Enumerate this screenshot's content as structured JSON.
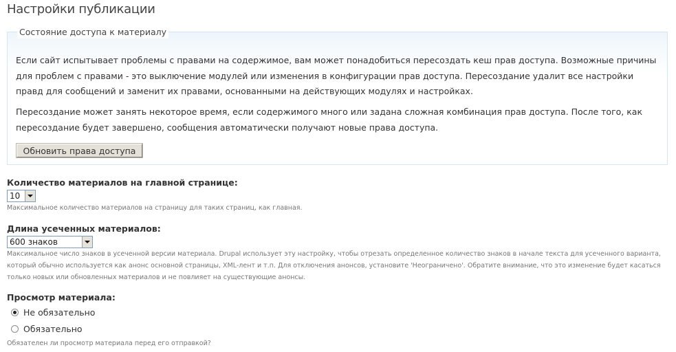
{
  "page": {
    "title": "Настройки публикации"
  },
  "access_fieldset": {
    "legend": "Состояние доступа к материалу",
    "paragraph_1": "Если сайт испытывает проблемы с правами на содержимое, вам может понадобиться пересоздать кеш прав доступа. Возможные причины для проблем с правами - это выключение модулей или изменения в конфигурации прав доступа. Пересоздание удалит все настройки правд для сообщений и заменит их правами, основанными на действующих модулях и настройках.",
    "paragraph_2": "Пересоздание может занять некоторое время, если содержимого много или задана сложная комбинация прав доступа. После того, как пересоздание будет завершено, сообщения автоматически получают новые права доступа.",
    "button_label": "Обновить права доступа"
  },
  "front_page_count": {
    "label": "Количество материалов на главной странице:",
    "selected": "10",
    "description": "Максимальное количество материалов на страницу для таких страниц, как главная."
  },
  "teaser_length": {
    "label": "Длина усеченных материалов:",
    "selected": "600 знаков",
    "description": "Максимальное число знаков в усеченной версии материала. Drupal использует эту настройку, чтобы отрезать определенное количество знаков в начале текста для усеченного варианта, который обычно используется как анонс основной страницы, XML-лент и т.п. Для отключения анонсов, установите 'Неограничено'. Обратите внимание, что это изменение будет касаться только новых или обновленных материалов и не повлияет на существующие анонсы."
  },
  "preview": {
    "label": "Просмотр материала:",
    "options": [
      {
        "label": "Не обязательно",
        "checked": true
      },
      {
        "label": "Обязательно",
        "checked": false
      }
    ],
    "description": "Обязателен ли просмотр материала перед его отправкой?"
  }
}
